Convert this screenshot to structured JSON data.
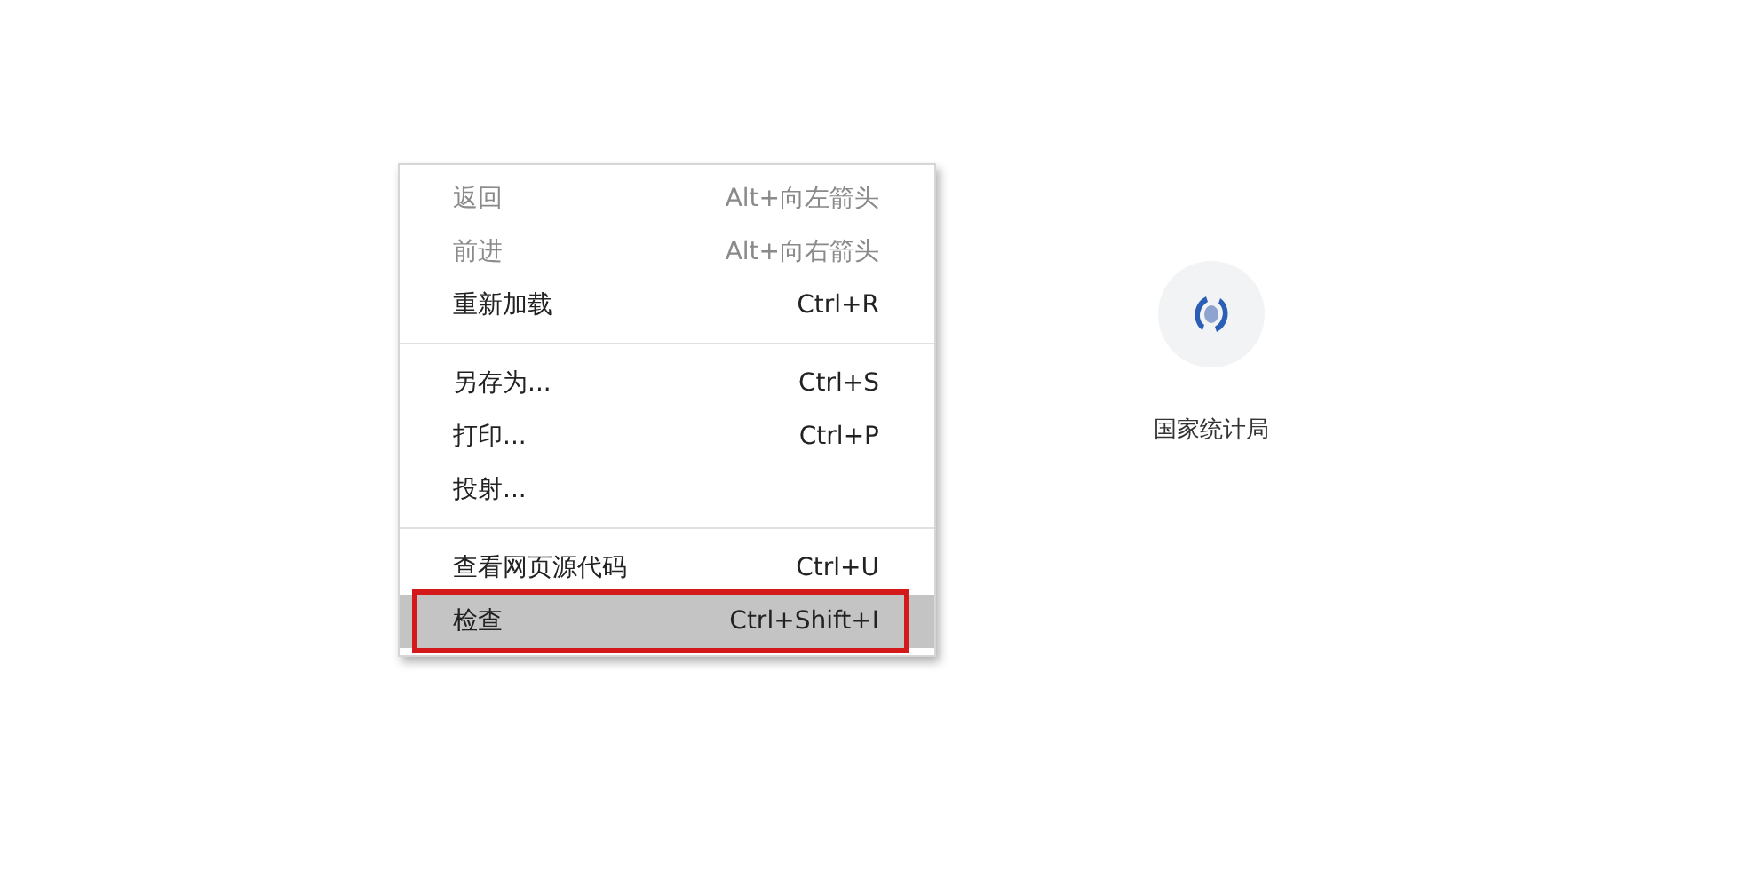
{
  "context_menu": {
    "groups": [
      {
        "items": [
          {
            "label": "返回",
            "shortcut": "Alt+向左箭头",
            "disabled": true,
            "selected": false,
            "outlined": false
          },
          {
            "label": "前进",
            "shortcut": "Alt+向右箭头",
            "disabled": true,
            "selected": false,
            "outlined": false
          },
          {
            "label": "重新加载",
            "shortcut": "Ctrl+R",
            "disabled": false,
            "selected": false,
            "outlined": false
          }
        ]
      },
      {
        "items": [
          {
            "label": "另存为...",
            "shortcut": "Ctrl+S",
            "disabled": false,
            "selected": false,
            "outlined": false
          },
          {
            "label": "打印...",
            "shortcut": "Ctrl+P",
            "disabled": false,
            "selected": false,
            "outlined": false
          },
          {
            "label": "投射...",
            "disabled": false,
            "selected": false,
            "outlined": false
          }
        ]
      },
      {
        "items": [
          {
            "label": "查看网页源代码",
            "shortcut": "Ctrl+U",
            "disabled": false,
            "selected": false,
            "outlined": false
          },
          {
            "label": "检查",
            "shortcut": "Ctrl+Shift+I",
            "disabled": false,
            "selected": true,
            "outlined": true
          }
        ]
      }
    ]
  },
  "shortcut_tile": {
    "label": "国家统计局"
  }
}
